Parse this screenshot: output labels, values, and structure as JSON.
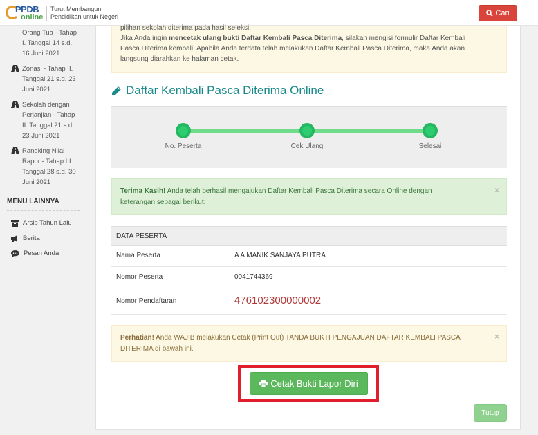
{
  "header": {
    "logo_ppdb": "PPDB",
    "logo_online": "online",
    "tagline_line1": "Turut Membangun",
    "tagline_line2": "Pendidikan untuk Negeri",
    "search_label": "Cari",
    "search_color": "#d9453a"
  },
  "sidebar": {
    "items": [
      {
        "icon": "road-icon",
        "lines": [
          "Orang Tua - Tahap",
          "I. Tanggal 14 s.d.",
          "16 Juni 2021"
        ],
        "has_icon": false
      },
      {
        "icon": "road-icon",
        "lines": [
          "Zonasi - Tahap II.",
          "Tanggal 21 s.d. 23",
          "Juni 2021"
        ]
      },
      {
        "icon": "road-icon",
        "lines": [
          "Sekolah dengan",
          "Perjanjian - Tahap",
          "II. Tanggal 21 s.d.",
          "23 Juni 2021"
        ]
      },
      {
        "icon": "road-icon",
        "lines": [
          "Rangking Nilai",
          "Rapor - Tahap III.",
          "Tanggal 28 s.d. 30",
          "Juni 2021"
        ]
      }
    ],
    "menu_title": "MENU LAINNYA",
    "menu_items": [
      {
        "icon": "archive-icon",
        "label": "Arsip Tahun Lalu"
      },
      {
        "icon": "megaphone-icon",
        "label": "Berita"
      },
      {
        "icon": "comment-icon",
        "label": "Pesan Anda"
      }
    ]
  },
  "main": {
    "top_alert": {
      "line1": "pilihan sekolah diterima pada hasil seleksi.",
      "line2_prefix": "Jika Anda ingin ",
      "line2_bold": "mencetak ulang bukti Daftar Kembali Pasca Diterima",
      "line2_suffix": ", silakan mengisi formulir Daftar Kembali",
      "line3": "Pasca Diterima kembali. Apabila Anda terdata telah melakukan Daftar Kembali Pasca Diterima, maka Anda akan",
      "line4": "langsung diarahkan ke halaman cetak."
    },
    "heading": "Daftar Kembali Pasca Diterima Online",
    "steps": [
      "No. Peserta",
      "Cek Ulang",
      "Selesai"
    ],
    "success_alert": {
      "bold": "Terima Kasih!",
      "text": " Anda telah berhasil mengajukan Daftar Kembali Pasca Diterima secara Online dengan",
      "line2": "keterangan sebagai berikut:",
      "close": "×"
    },
    "table": {
      "header": "DATA PESERTA",
      "rows": [
        {
          "label": "Nama Peserta",
          "value": "A A MANIK SANJAYA PUTRA"
        },
        {
          "label": "Nomor Peserta",
          "value": "0041744369"
        },
        {
          "label": "Nomor Pendaftaran",
          "value": "476102300000002"
        }
      ]
    },
    "warn_alert": {
      "bold": "Perhatian!",
      "text": " Anda WAJIB melakukan Cetak (Print Out) TANDA BUKTI PENGAJUAN DAFTAR KEMBALI PASCA",
      "line2": "DITERIMA di bawah ini.",
      "close": "×"
    },
    "print_button": "Cetak Bukti Lapor Diri",
    "close_button": "Tutup"
  }
}
